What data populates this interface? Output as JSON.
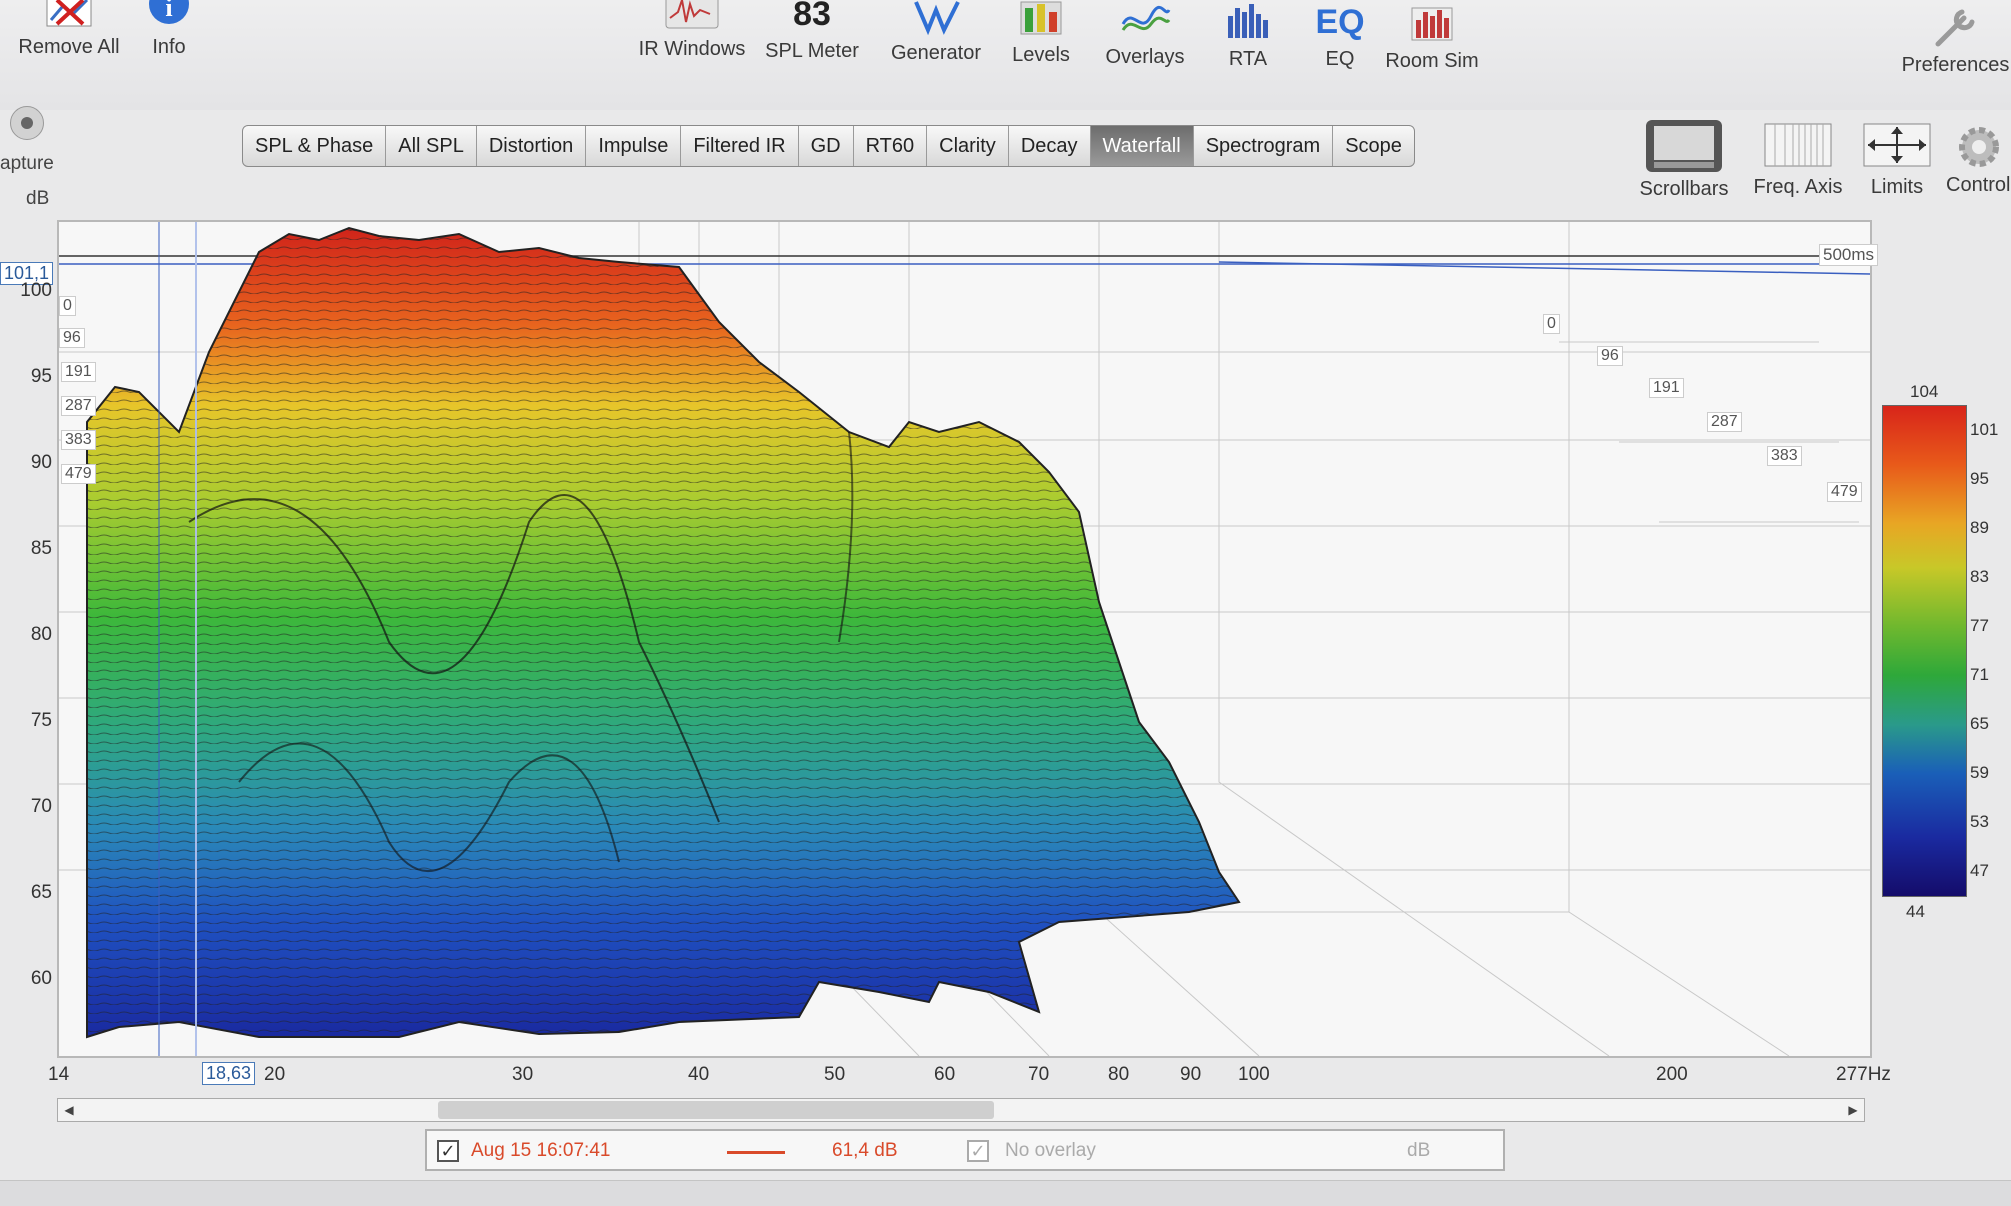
{
  "toolbar": {
    "remove_all": "Remove All",
    "info": "Info",
    "ir_windows": "IR Windows",
    "spl_meter_value": "83",
    "spl_meter": "SPL Meter",
    "generator": "Generator",
    "levels": "Levels",
    "overlays": "Overlays",
    "rta": "RTA",
    "eq_icon_text": "EQ",
    "eq": "EQ",
    "room_sim": "Room Sim",
    "preferences": "Preferences"
  },
  "side": {
    "capture": "apture",
    "db_unit": "dB"
  },
  "tabs": [
    "SPL & Phase",
    "All SPL",
    "Distortion",
    "Impulse",
    "Filtered IR",
    "GD",
    "RT60",
    "Clarity",
    "Decay",
    "Waterfall",
    "Spectrogram",
    "Scope"
  ],
  "active_tab": "Waterfall",
  "graph_controls": {
    "scrollbars": "Scrollbars",
    "freq_axis": "Freq. Axis",
    "limits": "Limits",
    "controls": "Control"
  },
  "graph": {
    "cursor_level": "101,1",
    "cursor_freq": "18,63",
    "time_span": "500ms",
    "y_ticks": [
      "100",
      "95",
      "90",
      "85",
      "80",
      "75",
      "70",
      "65",
      "60"
    ],
    "x_ticks": [
      "14",
      "20",
      "30",
      "40",
      "50",
      "60",
      "70",
      "80",
      "90",
      "100",
      "200",
      "277Hz"
    ],
    "time_slices_front": [
      "0",
      "96",
      "191",
      "287",
      "383",
      "479"
    ],
    "time_slices_back": [
      "0",
      "96",
      "191",
      "287",
      "383",
      "479"
    ]
  },
  "colour_scale": {
    "max": "104",
    "min": "44",
    "ticks": [
      "101",
      "95",
      "89",
      "83",
      "77",
      "71",
      "65",
      "59",
      "53",
      "47"
    ]
  },
  "legend": {
    "timestamp": "Aug 15 16:07:41",
    "trace_color": "#d94a2a",
    "level": "61,4 dB",
    "overlay": "No overlay",
    "overlay_unit": "dB"
  }
}
